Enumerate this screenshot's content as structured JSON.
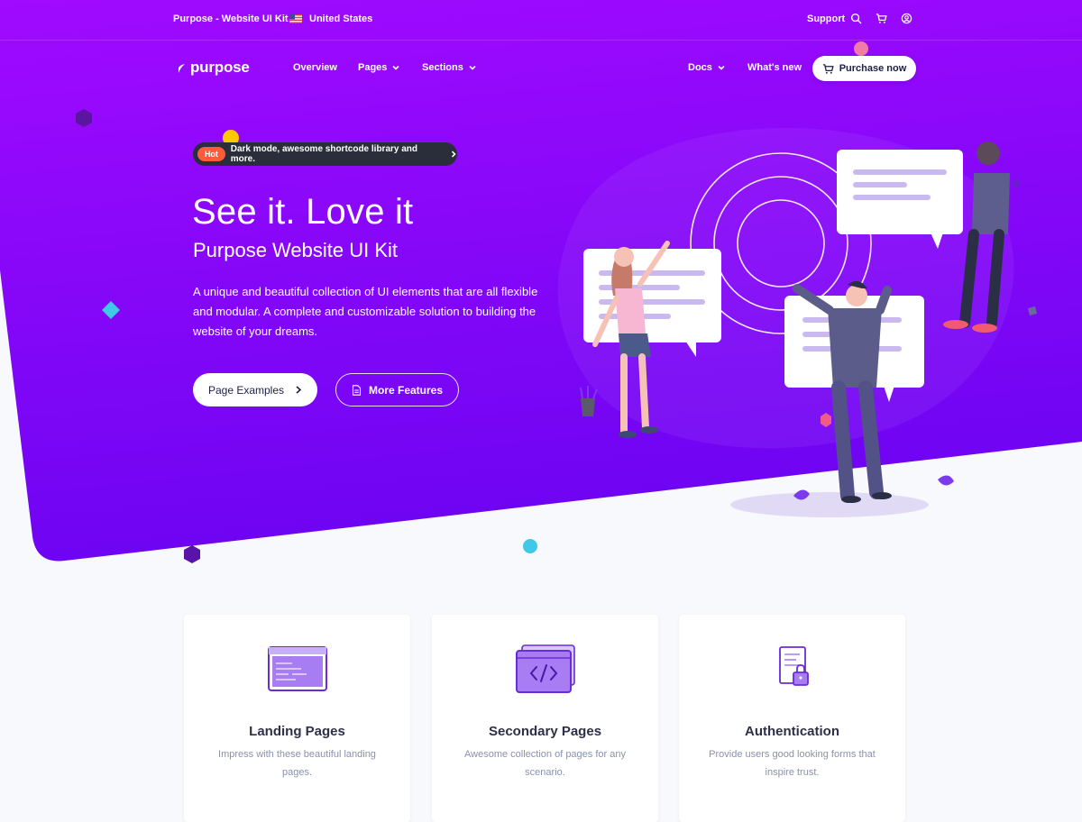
{
  "topbar": {
    "brand": "Purpose - Website UI Kit",
    "country": "United States",
    "support_label": "Support"
  },
  "nav": {
    "logo_text": "purpose",
    "links": [
      "Overview",
      "Pages",
      "Sections"
    ],
    "right_links": [
      "Docs",
      "What's new"
    ],
    "purchase_label": "Purchase now"
  },
  "announcement": {
    "badge": "Hot",
    "text": "Dark mode, awesome shortcode library and more."
  },
  "hero": {
    "title": "See it. Love it",
    "subtitle": "Purpose Website UI Kit",
    "description": "A unique and beautiful collection of UI elements that are all flexible and modular. A complete and customizable solution to building the website of your dreams.",
    "primary_button": "Page Examples",
    "secondary_button": "More Features"
  },
  "cards": [
    {
      "title": "Landing Pages",
      "description": "Impress with these beautiful landing pages.",
      "icon": "browser-window-icon"
    },
    {
      "title": "Secondary Pages",
      "description": "Awesome collection of pages for any scenario.",
      "icon": "code-window-icon"
    },
    {
      "title": "Authentication",
      "description": "Provide users good looking forms that inspire trust.",
      "icon": "lock-document-icon"
    }
  ],
  "colors": {
    "hero_gradient_start": "#9b0bff",
    "hero_gradient_end": "#6a05f2",
    "accent": "#7c3aed",
    "hot_badge": "#ff5a3a",
    "card_icon_fill": "#a87cf2"
  }
}
